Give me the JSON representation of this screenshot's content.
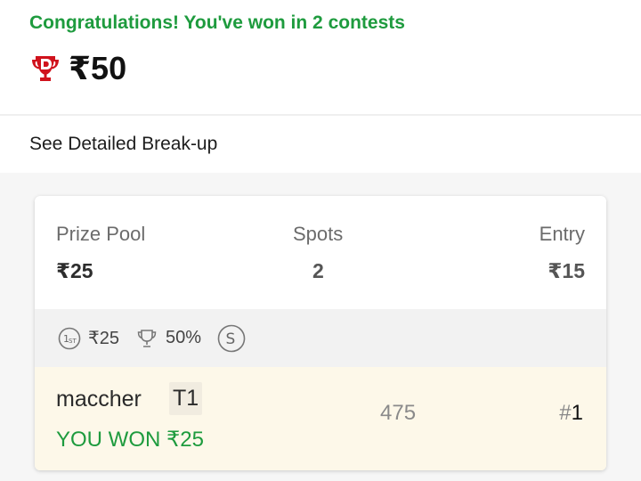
{
  "header": {
    "congrats_text": "Congratulations! You've won in 2 contests",
    "total_amount": "₹50",
    "trophy_icon": "trophy-d-icon",
    "accent_color": "#1e9b3e"
  },
  "breakup": {
    "label": "See Detailed Break-up"
  },
  "contest": {
    "prize_pool_label": "Prize Pool",
    "prize_pool_value": "₹25",
    "spots_label": "Spots",
    "spots_value": "2",
    "entry_label": "Entry",
    "entry_value": "₹15",
    "first_prize_icon": "first-place-icon",
    "first_prize_value": "₹25",
    "winners_icon": "trophy-outline-icon",
    "winners_percent": "50%",
    "single_entry_icon": "single-entry-s-icon",
    "team": {
      "name": "maccher",
      "tag": "T1",
      "won_text": "YOU WON ₹25",
      "points": "475",
      "rank_hash": "#",
      "rank_number": "1"
    }
  }
}
